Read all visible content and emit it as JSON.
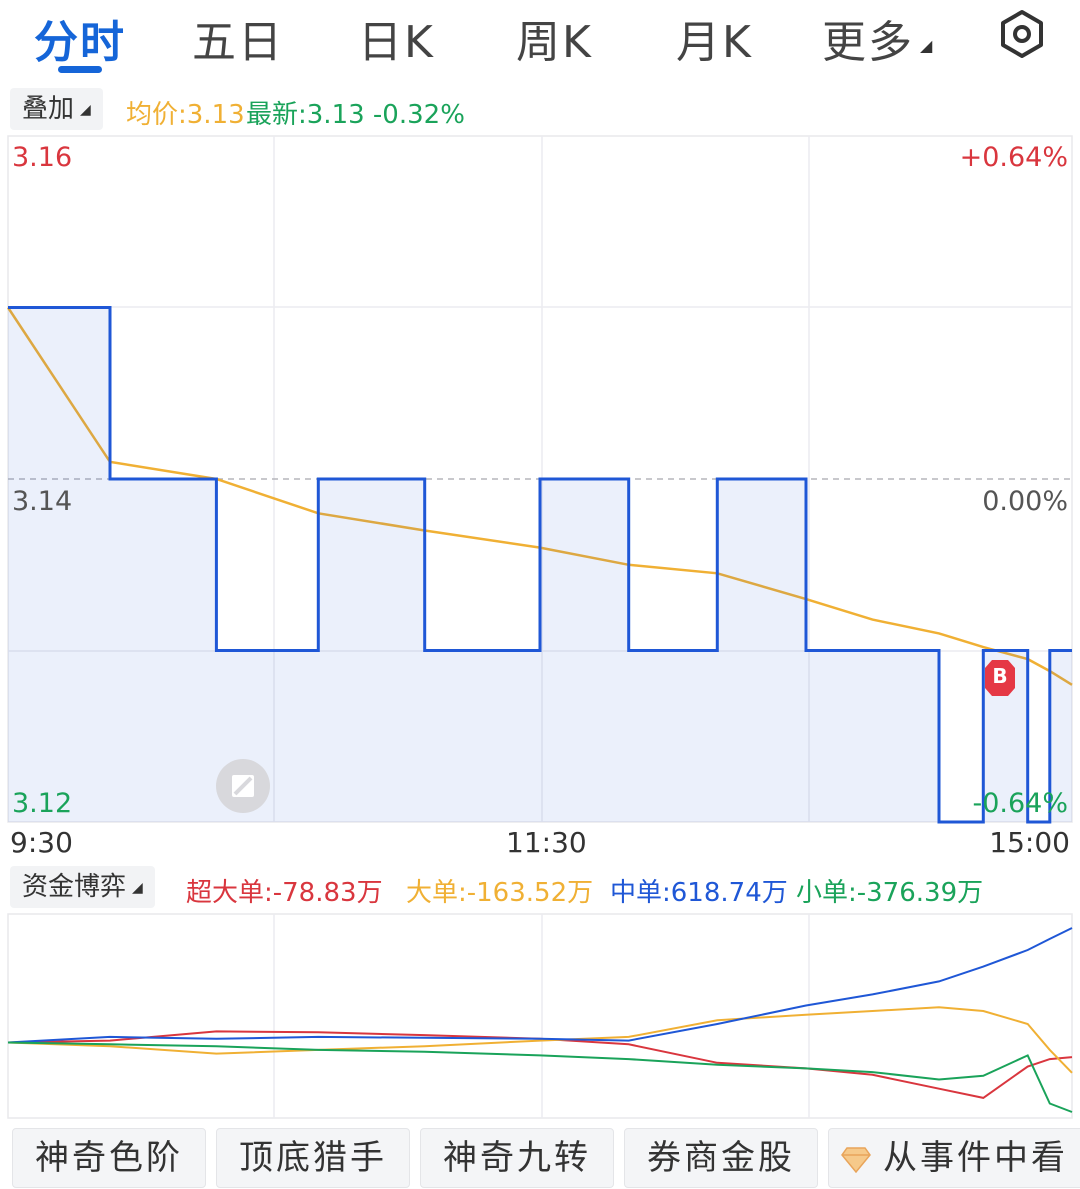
{
  "tabs": {
    "fenshi": "分时",
    "wuri": "五日",
    "rik": "日K",
    "zhouk": "周K",
    "yuek": "月K",
    "more": "更多"
  },
  "overlay": {
    "label": "叠加",
    "avg_price": "均价:3.13",
    "latest": "最新:3.13 -0.32%"
  },
  "main_chart": {
    "y_top": "3.16",
    "y_mid": "3.14",
    "y_bot": "3.12",
    "pct_top": "+0.64%",
    "pct_mid": "0.00%",
    "pct_bot": "-0.64%",
    "x_start": "9:30",
    "x_mid": "11:30",
    "x_end": "15:00",
    "buy_marker": "B"
  },
  "fund_flow": {
    "label": "资金博弈",
    "super_large": "超大单:-78.83万",
    "large": "大单:-163.52万",
    "medium": "中单:618.74万",
    "small": "小单:-376.39万"
  },
  "toolbar": {
    "item1": "神奇色阶",
    "item2": "顶底猎手",
    "item3": "神奇九转",
    "item4": "券商金股",
    "item5": "从事件中看"
  },
  "colors": {
    "accent": "#1565d8",
    "up": "#d9363e",
    "down": "#1aa35a",
    "avg": "#f0b034",
    "price": "#1f57d6"
  },
  "chart_data": [
    {
      "type": "line",
      "title": "",
      "x_range": [
        "9:30",
        "15:00"
      ],
      "ylim": [
        3.12,
        3.16
      ],
      "y_right_labels": [
        "+0.64%",
        "0.00%",
        "-0.64%"
      ],
      "reference_price": 3.14,
      "series": [
        {
          "name": "均价",
          "values": [
            3.15,
            3.141,
            3.14,
            3.138,
            3.137,
            3.136,
            3.135,
            3.1345,
            3.133,
            3.1318,
            3.131,
            3.1302,
            3.1295,
            3.1288,
            3.128
          ]
        },
        {
          "name": "最新",
          "values": [
            3.15,
            3.14,
            3.13,
            3.14,
            3.13,
            3.14,
            3.13,
            3.14,
            3.13,
            3.13,
            3.12,
            3.13,
            3.12,
            3.13,
            3.13
          ]
        }
      ],
      "x": [
        "9:30",
        "9:53",
        "10:17",
        "10:40",
        "11:04",
        "11:30",
        "13:20",
        "13:40",
        "14:00",
        "14:15",
        "14:30",
        "14:40",
        "14:50",
        "14:55",
        "15:00"
      ]
    },
    {
      "type": "line",
      "title": "",
      "x_range": [
        "9:30",
        "15:00"
      ],
      "series": [
        {
          "name": "超大单",
          "values": [
            0,
            10,
            60,
            55,
            40,
            20,
            -10,
            -110,
            -140,
            -175,
            -250,
            -300,
            -130,
            -90,
            -79
          ]
        },
        {
          "name": "大单",
          "values": [
            0,
            -20,
            -60,
            -40,
            -20,
            10,
            30,
            120,
            150,
            170,
            190,
            170,
            100,
            -40,
            -164
          ]
        },
        {
          "name": "中单",
          "values": [
            0,
            30,
            20,
            30,
            25,
            20,
            10,
            100,
            200,
            260,
            330,
            410,
            500,
            560,
            619
          ]
        },
        {
          "name": "小单",
          "values": [
            0,
            -10,
            -20,
            -40,
            -50,
            -70,
            -90,
            -120,
            -140,
            -160,
            -200,
            -180,
            -70,
            -330,
            -376
          ]
        }
      ]
    }
  ]
}
